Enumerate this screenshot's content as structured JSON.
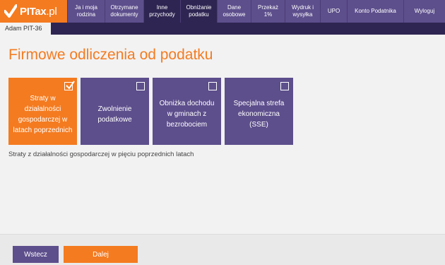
{
  "brand": {
    "name": "PITax",
    "suffix": ".pl"
  },
  "nav": [
    {
      "label": "Ja i moja rodzina",
      "active": false
    },
    {
      "label": "Otrzymane dokumenty",
      "active": false
    },
    {
      "label": "Inne przychody",
      "active": true
    },
    {
      "label": "Obniżanie podatku",
      "active": true
    },
    {
      "label": "Dane osobowe",
      "active": false
    },
    {
      "label": "Przekaż 1%",
      "active": false
    },
    {
      "label": "Wydruk i wysyłka",
      "active": false
    },
    {
      "label": "UPO",
      "active": false
    },
    {
      "label": "Konto Podatnika",
      "active": false
    },
    {
      "label": "Wyloguj",
      "active": false
    }
  ],
  "user_tab": "Adam PIT-36",
  "page_title": "Firmowe odliczenia od podatku",
  "tiles": [
    {
      "label": "Straty w działalności gospodarczej w latach poprzednich",
      "checked": true
    },
    {
      "label": "Zwolnienie podatkowe",
      "checked": false
    },
    {
      "label": "Obniżka dochodu w gminach z bezrobociem",
      "checked": false
    },
    {
      "label": "Specjalna strefa ekonomiczna (SSE)",
      "checked": false
    }
  ],
  "description": "Straty z działalności gospodarczej w pięciu poprzednich latach",
  "footer": {
    "back_label": "Wstecz",
    "next_label": "Dalej"
  },
  "colors": {
    "orange": "#f47b20",
    "purple": "#5d4e8c",
    "dark_purple": "#2f2552"
  }
}
